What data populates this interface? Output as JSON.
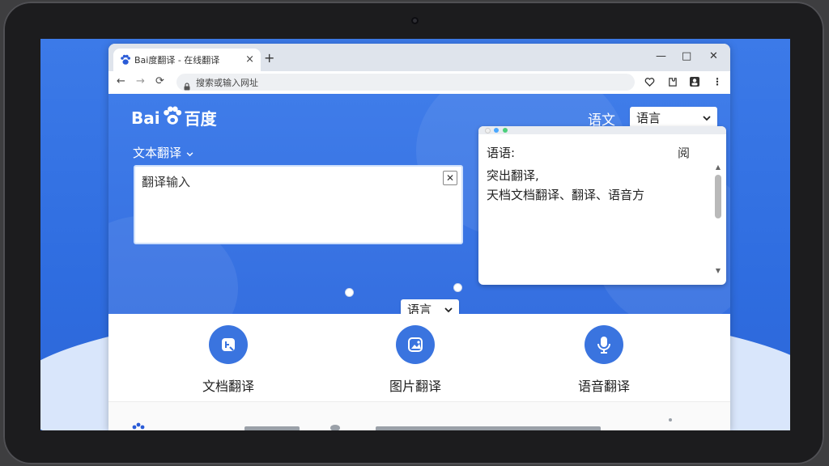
{
  "browser": {
    "tab_title": "Bai度翻译 - 在线翻译",
    "tab_close": "×",
    "new_tab": "+",
    "window_controls": {
      "minimize": "—",
      "maximize": "□",
      "close": "✕"
    },
    "nav": {
      "back": "←",
      "forward": "→",
      "reload": "⟳"
    },
    "address": "搜索或输入网址",
    "toolbar_icons": [
      "heart-icon",
      "extension-icon",
      "profile-icon",
      "menu-icon"
    ],
    "menu_glyph": "⋮"
  },
  "page": {
    "logo": {
      "prefix": "Bai",
      "suffix": "百度"
    },
    "target_language_label": "语文",
    "target_language_select": "语言",
    "mode_label": "文本翻译",
    "input": {
      "text": "翻译输入",
      "clear": "✕"
    },
    "source_language_select": "语言",
    "output": {
      "label": "语语:",
      "action": "阅",
      "lines": [
        "突出翻译,",
        "天档文档翻译、翻译、语音方"
      ]
    },
    "features": [
      {
        "label": "文档翻译",
        "icon": "document-translate-icon"
      },
      {
        "label": "图片翻译",
        "icon": "image-translate-icon"
      },
      {
        "label": "语音翻译",
        "icon": "voice-translate-icon"
      }
    ]
  },
  "colors": {
    "brand_blue": "#3a74df",
    "page_blue": "#3f7ce9",
    "wallpaper_blue": "#2f6fe0"
  }
}
